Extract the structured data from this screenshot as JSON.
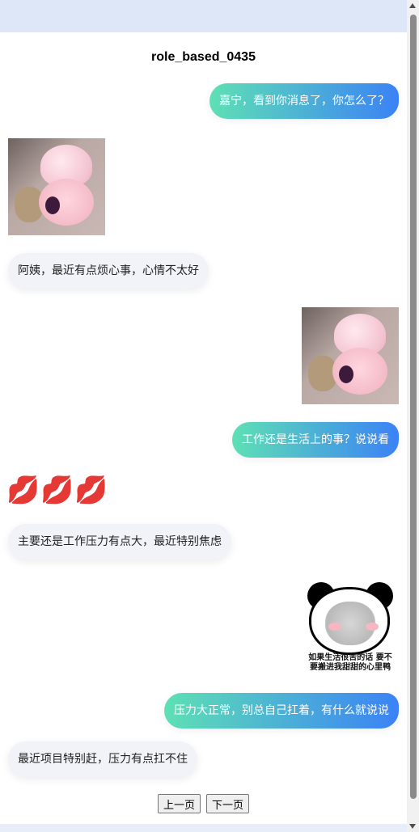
{
  "title": "role_based_0435",
  "messages": [
    {
      "side": "right",
      "type": "text",
      "text": "嘉宁，看到你消息了，你怎么了？"
    },
    {
      "side": "left",
      "type": "sticker",
      "icon": "baby-sticker"
    },
    {
      "side": "left",
      "type": "text",
      "text": "阿姨，最近有点烦心事，心情不太好"
    },
    {
      "side": "right",
      "type": "sticker",
      "icon": "baby-sticker"
    },
    {
      "side": "right",
      "type": "text",
      "text": "工作还是生活上的事？说说看"
    },
    {
      "side": "left",
      "type": "emoji",
      "text": "💋💋💋"
    },
    {
      "side": "left",
      "type": "text",
      "text": "主要还是工作压力有点大，最近特别焦虑"
    },
    {
      "side": "right",
      "type": "sticker",
      "icon": "panda-meme-sticker",
      "caption_line1": "如果生活很苦的话 要不",
      "caption_line2": "要搬进我甜甜的心里鸭"
    },
    {
      "side": "right",
      "type": "text",
      "text": "压力大正常，别总自己扛着，有什么就说说"
    },
    {
      "side": "left",
      "type": "text",
      "text": "最近项目特别赶，压力有点扛不住"
    }
  ],
  "pagination": {
    "prev_label": "上一页",
    "next_label": "下一页"
  },
  "colors": {
    "right_bubble_start": "#5ee0b4",
    "right_bubble_end": "#3b82f6",
    "left_bubble": "#f1f3f8"
  }
}
